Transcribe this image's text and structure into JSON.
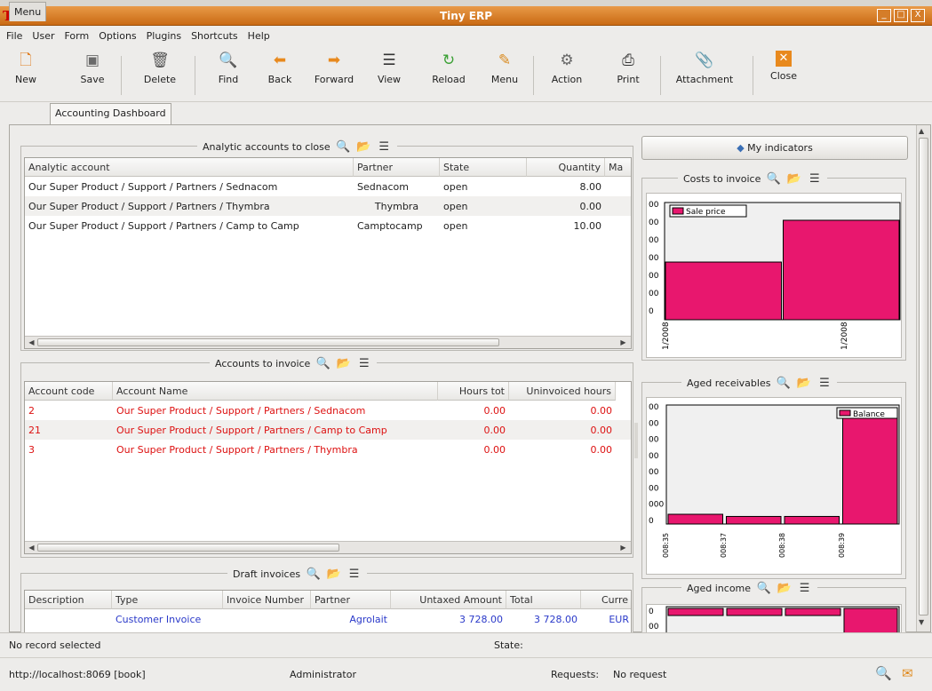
{
  "window": {
    "title": "Tiny ERP",
    "minimize": "_",
    "maximize": "□",
    "close": "X"
  },
  "menubar": [
    "File",
    "User",
    "Form",
    "Options",
    "Plugins",
    "Shortcuts",
    "Help"
  ],
  "toolbar": {
    "new": "New",
    "save": "Save",
    "delete": "Delete",
    "find": "Find",
    "back": "Back",
    "forward": "Forward",
    "view": "View",
    "reload": "Reload",
    "menu": "Menu",
    "action": "Action",
    "print": "Print",
    "attachment": "Attachment",
    "close": "Close"
  },
  "tabs": [
    "Menu",
    "Accounting Dashboard"
  ],
  "analytic": {
    "title": "Analytic accounts to close",
    "columns": [
      "Analytic account",
      "Partner",
      "State",
      "Quantity",
      "Ma"
    ],
    "rows": [
      [
        "Our Super Product / Support / Partners / Sednacom",
        "Sednacom",
        "open",
        "8.00"
      ],
      [
        "Our Super Product / Support / Partners / Thymbra",
        "Thymbra",
        "open",
        "0.00"
      ],
      [
        "Our Super Product / Support / Partners / Camp to Camp",
        "Camptocamp",
        "open",
        "10.00"
      ]
    ]
  },
  "accounts": {
    "title": "Accounts to invoice",
    "columns": [
      "Account code",
      "Account Name",
      "Hours tot",
      "Uninvoiced hours"
    ],
    "rows": [
      [
        "2",
        "Our Super Product / Support / Partners / Sednacom",
        "0.00",
        "0.00"
      ],
      [
        "21",
        "Our Super Product / Support / Partners / Camp to Camp",
        "0.00",
        "0.00"
      ],
      [
        "3",
        "Our Super Product / Support / Partners / Thymbra",
        "0.00",
        "0.00"
      ]
    ]
  },
  "drafts": {
    "title": "Draft invoices",
    "columns": [
      "Description",
      "Type",
      "Invoice Number",
      "Partner",
      "Untaxed Amount",
      "Total",
      "Curre"
    ],
    "rows": [
      [
        "",
        "Customer Invoice",
        "",
        "Agrolait",
        "3 728.00",
        "3 728.00",
        "EUR"
      ]
    ]
  },
  "indicators": {
    "button": "My indicators"
  },
  "charts": {
    "costs": {
      "title": "Costs to invoice",
      "legend": "Sale price",
      "ticks": [
        "00",
        "00",
        "00",
        "00",
        "00",
        "00",
        "0"
      ],
      "xlabels": [
        "1/2008",
        "1/2008"
      ],
      "bar_color": "#e8176e"
    },
    "aged": {
      "title": "Aged receivables",
      "legend": "Balance",
      "ticks": [
        "00",
        "00",
        "00",
        "00",
        "00",
        "00",
        "000",
        "0"
      ],
      "xlabels": [
        "008:35",
        "008:37",
        "008:38",
        "008:39"
      ],
      "bar_color": "#e8176e"
    },
    "income": {
      "title": "Aged income",
      "ticks": [
        "0",
        "00"
      ],
      "bar_color": "#e8176e"
    }
  },
  "chart_data": [
    {
      "type": "bar",
      "title": "Costs to invoice",
      "series": [
        {
          "name": "Sale price",
          "values": [
            0.58,
            1.0
          ]
        }
      ],
      "categories": [
        "1/2008",
        "1/2008"
      ]
    },
    {
      "type": "bar",
      "title": "Aged receivables",
      "series": [
        {
          "name": "Balance",
          "values": [
            0.09,
            0.07,
            0.07,
            1.0
          ]
        }
      ],
      "categories": [
        "008:35",
        "008:37",
        "008:38",
        "008:39"
      ]
    }
  ],
  "status": {
    "selection": "No record selected",
    "state_label": "State:"
  },
  "footer": {
    "url": "http://localhost:8069 [book]",
    "user": "Administrator",
    "requests_label": "Requests:",
    "requests_value": "No request"
  }
}
